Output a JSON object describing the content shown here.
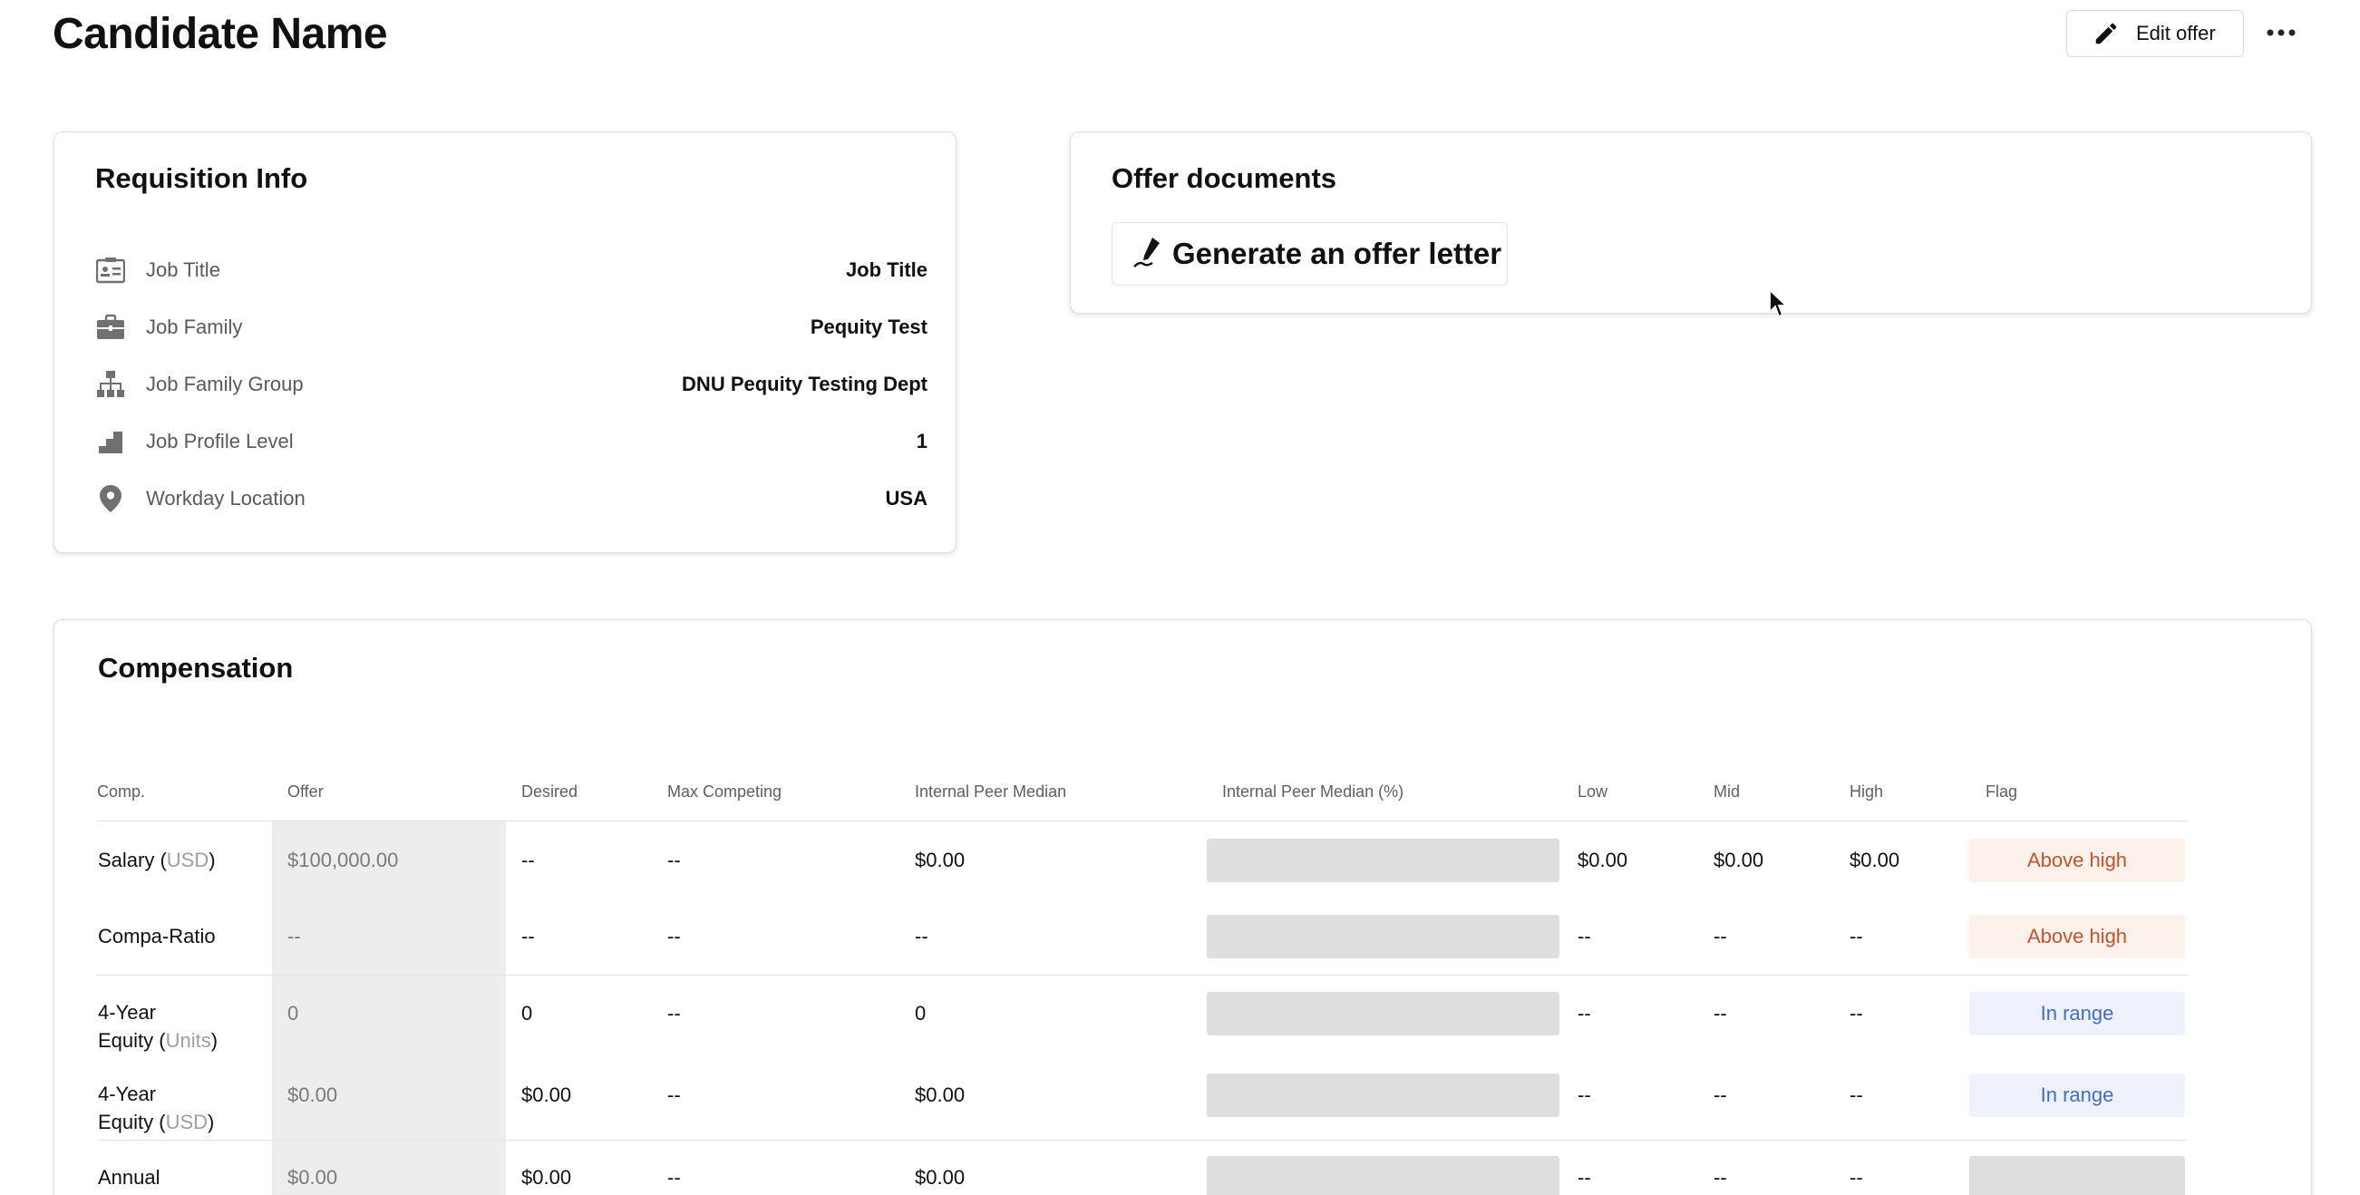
{
  "page": {
    "title": "Candidate Name"
  },
  "header": {
    "edit_label": "Edit offer"
  },
  "requisition": {
    "title": "Requisition Info",
    "rows": [
      {
        "icon": "id-card-icon",
        "label": "Job Title",
        "value": "Job Title"
      },
      {
        "icon": "briefcase-icon",
        "label": "Job Family",
        "value": "Pequity Test"
      },
      {
        "icon": "org-chart-icon",
        "label": "Job Family Group",
        "value": "DNU Pequity Testing Dept"
      },
      {
        "icon": "stairs-icon",
        "label": "Job Profile Level",
        "value": "1"
      },
      {
        "icon": "location-pin-icon",
        "label": "Workday Location",
        "value": "USA"
      }
    ]
  },
  "documents": {
    "title": "Offer documents",
    "generate_label": "Generate an offer letter"
  },
  "compensation": {
    "title": "Compensation",
    "columns": [
      "Comp.",
      "Offer",
      "Desired",
      "Max Competing",
      "Internal Peer Median",
      "Internal Peer Median (%)",
      "Low",
      "Mid",
      "High",
      "Flag"
    ],
    "rows": [
      {
        "label_a": "Salary (",
        "unit": "USD",
        "label_b": ")",
        "offer": "$100,000.00",
        "desired": "--",
        "max_competing": "--",
        "peer_median": "$0.00",
        "low": "$0.00",
        "mid": "$0.00",
        "high": "$0.00",
        "flag": "Above high"
      },
      {
        "label": "Compa-Ratio",
        "offer": "--",
        "desired": "--",
        "max_competing": "--",
        "peer_median": "--",
        "low": "--",
        "mid": "--",
        "high": "--",
        "flag": "Above high"
      },
      {
        "label_line1": "4-Year",
        "label_line2a": "Equity (",
        "unit": "Units",
        "label_line2b": ")",
        "offer": "0",
        "desired": "0",
        "max_competing": "--",
        "peer_median": "0",
        "low": "--",
        "mid": "--",
        "high": "--",
        "flag": "In range"
      },
      {
        "label_line1": "4-Year",
        "label_line2a": "Equity (",
        "unit": "USD",
        "label_line2b": ")",
        "offer": "$0.00",
        "desired": "$0.00",
        "max_competing": "--",
        "peer_median": "$0.00",
        "low": "--",
        "mid": "--",
        "high": "--",
        "flag": "In range"
      },
      {
        "label": "Annual",
        "offer": "$0.00",
        "desired": "$0.00",
        "max_competing": "--",
        "peer_median": "$0.00",
        "low": "--",
        "mid": "--",
        "high": "--",
        "flag": ""
      }
    ]
  },
  "colors": {
    "above_high": "#c8532a",
    "above_high_bg": "#fdf1ec",
    "in_range": "#3f6ecf",
    "in_range_bg": "#eef2fd",
    "unit": "#9aa0a6"
  }
}
